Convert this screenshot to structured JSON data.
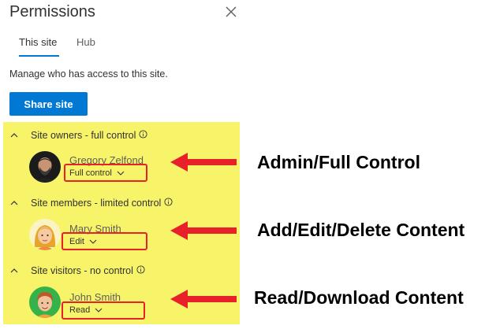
{
  "panel": {
    "title": "Permissions",
    "tabs": [
      "This site",
      "Hub"
    ],
    "description": "Manage who has access to this site.",
    "share_button": "Share site"
  },
  "groups": [
    {
      "title": "Site owners - full control",
      "member": "Gregory Zelfond",
      "permission": "Full control",
      "annotation": "Admin/Full Control"
    },
    {
      "title": "Site members - limited control",
      "member": "Mary Smith",
      "permission": "Edit",
      "annotation": "Add/Edit/Delete Content"
    },
    {
      "title": "Site visitors - no control",
      "member": "John Smith",
      "permission": "Read",
      "annotation": "Read/Download Content"
    }
  ],
  "colors": {
    "accent": "#0078d4",
    "highlight": "#f7f46a",
    "annotation_red": "#e8202a"
  },
  "icons": [
    "close-icon",
    "chevron-up-icon",
    "info-icon",
    "chevron-down-icon",
    "arrow-left-icon"
  ]
}
